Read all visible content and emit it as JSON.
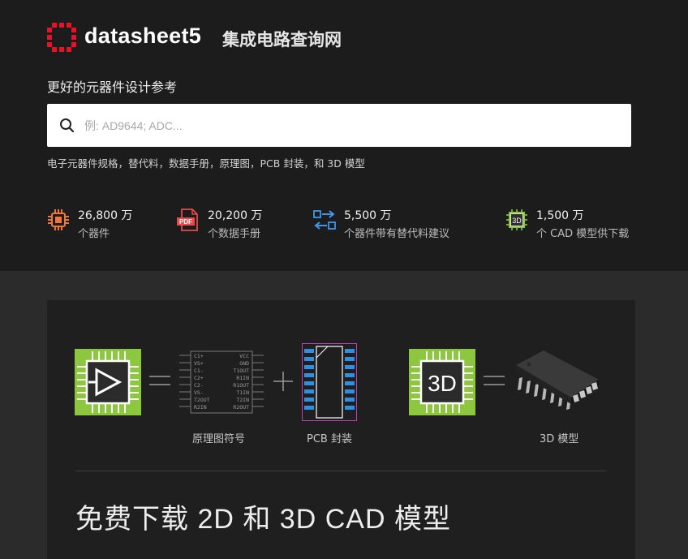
{
  "header": {
    "brand": "datasheet5",
    "brand_sub": "集成电路查询网",
    "tagline": "更好的元器件设计参考",
    "accent_color": "#e5132a"
  },
  "search": {
    "placeholder": "例: AD9644; ADC...",
    "value": ""
  },
  "sub_description": "电子元器件规格，替代料，数据手册，原理图，PCB 封装，和 3D 模型",
  "stats": [
    {
      "icon": "chip-icon",
      "number": "26,800 万",
      "label": "个器件"
    },
    {
      "icon": "pdf-icon",
      "number": "20,200 万",
      "label": "个数据手册"
    },
    {
      "icon": "swap-icon",
      "number": "5,500 万",
      "label": "个器件带有替代料建议"
    },
    {
      "icon": "3d-icon",
      "number": "1,500 万",
      "label": "个 CAD 模型供下载"
    }
  ],
  "pdf_badge": "PDF",
  "feature": {
    "schematic_caption": "原理图符号",
    "pcb_caption": "PCB 封装",
    "model_caption": "3D 模型",
    "chip_3d_label": "3D",
    "pins_left": [
      "C1+",
      "VS+",
      "C1-",
      "C2+",
      "C2-",
      "VS-",
      "T2OUT",
      "R2IN"
    ],
    "pins_right": [
      "VCC",
      "GND",
      "T1OUT",
      "R1IN",
      "R1OUT",
      "T1IN",
      "T2IN",
      "R2OUT"
    ],
    "headline": "免费下载 2D 和 3D CAD 模型"
  }
}
